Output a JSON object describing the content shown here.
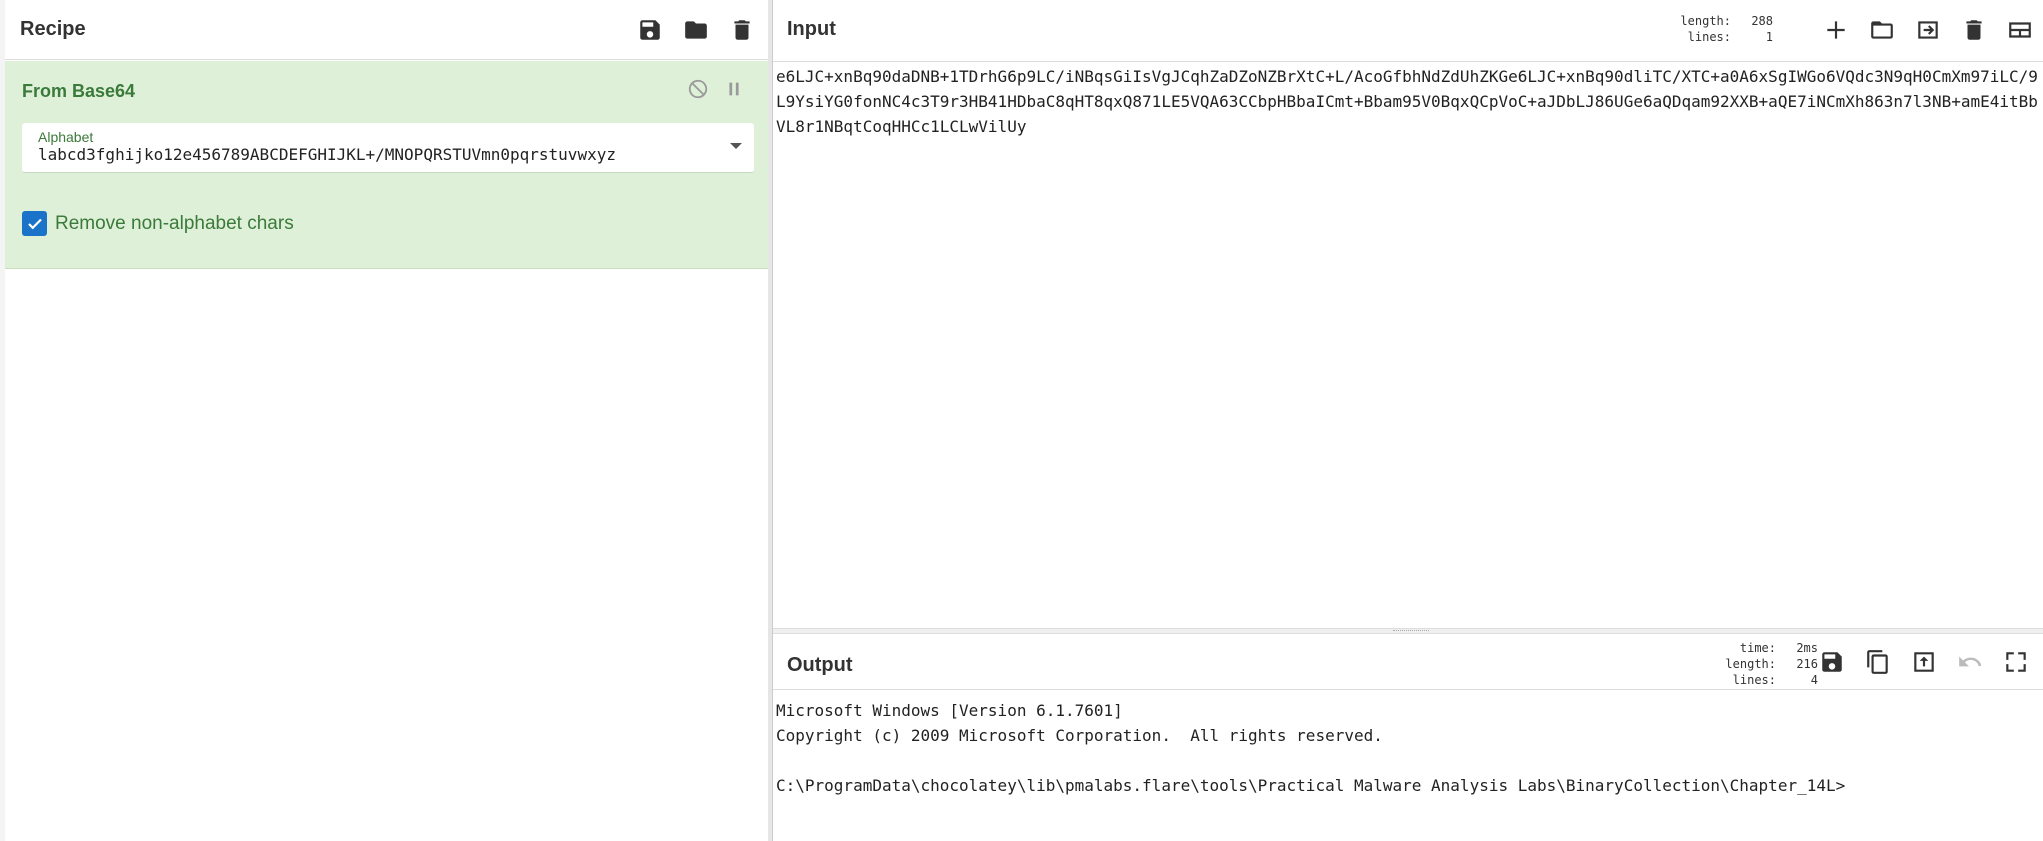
{
  "recipe": {
    "title": "Recipe",
    "operation": {
      "name": "From Base64",
      "alphabet_label": "Alphabet",
      "alphabet_value": "labcd3fghijko12e456789ABCDEFGHIJKL+/MNOPQRSTUVmn0pqrstuvwxyz",
      "checkbox_label": "Remove non-alphabet chars"
    }
  },
  "input": {
    "title": "Input",
    "meta": {
      "length_label": "length:",
      "length": "288",
      "lines_label": "lines:",
      "lines": "1"
    },
    "text": "e6LJC+xnBq90daDNB+1TDrhG6p9LC/iNBqsGiIsVgJCqhZaDZoNZBrXtC+L/AcoGfbhNdZdUhZKGe6LJC+xnBq90dliTC/XTC+a0A6xSgIWGo6VQdc3N9qH0CmXm97iLC/9L9YsiYG0fonNC4c3T9r3HB41HDbaC8qHT8qxQ871LE5VQA63CCbpHBbaICmt+Bbam95V0BqxQCpVoC+aJDbLJ86UGe6aQDqam92XXB+aQE7iNCmXh863n7l3NB+amE4itBbVL8r1NBqtCoqHHCc1LCLwVilUy"
  },
  "output": {
    "title": "Output",
    "meta": {
      "time_label": "time:",
      "time": "2ms",
      "length_label": "length:",
      "length": "216",
      "lines_label": "lines:",
      "lines": "4"
    },
    "line1": "Microsoft Windows [Version 6.1.7601]",
    "line2": "Copyright (c) 2009 Microsoft Corporation.  All rights reserved.",
    "line3": "",
    "line4": "C:\\ProgramData\\chocolatey\\lib\\pmalabs.flare\\tools\\Practical Malware Analysis Labs\\BinaryCollection\\Chapter_14L>"
  }
}
